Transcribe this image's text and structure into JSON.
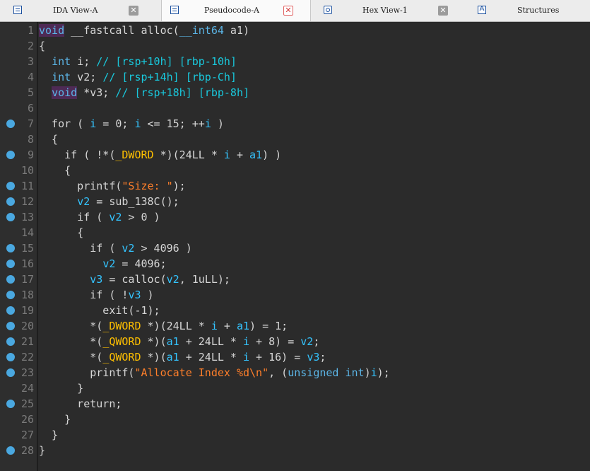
{
  "tabs": [
    {
      "label": "IDA View-A",
      "close": "✕",
      "icon": "disassembly-icon",
      "active": false
    },
    {
      "label": "Pseudocode-A",
      "close": "✕",
      "icon": "pseudocode-icon",
      "active": true
    },
    {
      "label": "Hex View-1",
      "close": "✕",
      "icon": "hex-view-icon",
      "active": false
    },
    {
      "label": "Structures",
      "icon": "structures-icon",
      "active": false
    }
  ],
  "colors": {
    "background": "#2b2b2b",
    "keyword": "#5bb4e5",
    "string": "#ff7f2a",
    "type": "#ffc000",
    "comment": "#19c8dc",
    "breakpoint": "#4aa8e0"
  },
  "lines": [
    {
      "n": "1",
      "bp": false,
      "tokens": [
        [
          "kwh",
          "void"
        ],
        [
          "p",
          " __fastcall alloc("
        ],
        [
          "kw",
          "__int64"
        ],
        [
          "p",
          " a1)"
        ]
      ]
    },
    {
      "n": "2",
      "bp": false,
      "tokens": [
        [
          "p",
          "{"
        ]
      ]
    },
    {
      "n": "3",
      "bp": false,
      "tokens": [
        [
          "p",
          "  "
        ],
        [
          "kw",
          "int"
        ],
        [
          "p",
          " i; "
        ],
        [
          "com",
          "// [rsp+10h] [rbp-10h]"
        ]
      ]
    },
    {
      "n": "4",
      "bp": false,
      "tokens": [
        [
          "p",
          "  "
        ],
        [
          "kw",
          "int"
        ],
        [
          "p",
          " v2; "
        ],
        [
          "com",
          "// [rsp+14h] [rbp-Ch]"
        ]
      ]
    },
    {
      "n": "5",
      "bp": false,
      "tokens": [
        [
          "p",
          "  "
        ],
        [
          "kwh",
          "void"
        ],
        [
          "p",
          " *v3; "
        ],
        [
          "com",
          "// [rsp+18h] [rbp-8h]"
        ]
      ]
    },
    {
      "n": "6",
      "bp": false,
      "tokens": []
    },
    {
      "n": "7",
      "bp": true,
      "tokens": [
        [
          "p",
          "  for ( "
        ],
        [
          "var",
          "i"
        ],
        [
          "p",
          " = 0; "
        ],
        [
          "var",
          "i"
        ],
        [
          "p",
          " <= 15; ++"
        ],
        [
          "var",
          "i"
        ],
        [
          "p",
          " )"
        ]
      ]
    },
    {
      "n": "8",
      "bp": false,
      "tokens": [
        [
          "p",
          "  {"
        ]
      ]
    },
    {
      "n": "9",
      "bp": true,
      "tokens": [
        [
          "p",
          "    if ( !*("
        ],
        [
          "typ",
          "_DWORD"
        ],
        [
          "p",
          " *)(24LL * "
        ],
        [
          "var",
          "i"
        ],
        [
          "p",
          " + "
        ],
        [
          "var",
          "a1"
        ],
        [
          "p",
          ") )"
        ]
      ]
    },
    {
      "n": "10",
      "bp": false,
      "tokens": [
        [
          "p",
          "    {"
        ]
      ]
    },
    {
      "n": "11",
      "bp": true,
      "tokens": [
        [
          "p",
          "      printf("
        ],
        [
          "str",
          "\"Size: \""
        ],
        [
          "p",
          ");"
        ]
      ]
    },
    {
      "n": "12",
      "bp": true,
      "tokens": [
        [
          "p",
          "      "
        ],
        [
          "var",
          "v2"
        ],
        [
          "p",
          " = sub_138C();"
        ]
      ]
    },
    {
      "n": "13",
      "bp": true,
      "tokens": [
        [
          "p",
          "      if ( "
        ],
        [
          "var",
          "v2"
        ],
        [
          "p",
          " > 0 )"
        ]
      ]
    },
    {
      "n": "14",
      "bp": false,
      "tokens": [
        [
          "p",
          "      {"
        ]
      ]
    },
    {
      "n": "15",
      "bp": true,
      "tokens": [
        [
          "p",
          "        if ( "
        ],
        [
          "var",
          "v2"
        ],
        [
          "p",
          " > 4096 )"
        ]
      ]
    },
    {
      "n": "16",
      "bp": true,
      "tokens": [
        [
          "p",
          "          "
        ],
        [
          "var",
          "v2"
        ],
        [
          "p",
          " = 4096;"
        ]
      ]
    },
    {
      "n": "17",
      "bp": true,
      "tokens": [
        [
          "p",
          "        "
        ],
        [
          "var",
          "v3"
        ],
        [
          "p",
          " = calloc("
        ],
        [
          "var",
          "v2"
        ],
        [
          "p",
          ", 1uLL);"
        ]
      ]
    },
    {
      "n": "18",
      "bp": true,
      "tokens": [
        [
          "p",
          "        if ( !"
        ],
        [
          "var",
          "v3"
        ],
        [
          "p",
          " )"
        ]
      ]
    },
    {
      "n": "19",
      "bp": true,
      "tokens": [
        [
          "p",
          "          exit(-1);"
        ]
      ]
    },
    {
      "n": "20",
      "bp": true,
      "tokens": [
        [
          "p",
          "        *("
        ],
        [
          "typ",
          "_DWORD"
        ],
        [
          "p",
          " *)(24LL * "
        ],
        [
          "var",
          "i"
        ],
        [
          "p",
          " + "
        ],
        [
          "var",
          "a1"
        ],
        [
          "p",
          ") = 1;"
        ]
      ]
    },
    {
      "n": "21",
      "bp": true,
      "tokens": [
        [
          "p",
          "        *("
        ],
        [
          "typ",
          "_QWORD"
        ],
        [
          "p",
          " *)("
        ],
        [
          "var",
          "a1"
        ],
        [
          "p",
          " + 24LL * "
        ],
        [
          "var",
          "i"
        ],
        [
          "p",
          " + 8) = "
        ],
        [
          "var",
          "v2"
        ],
        [
          "p",
          ";"
        ]
      ]
    },
    {
      "n": "22",
      "bp": true,
      "tokens": [
        [
          "p",
          "        *("
        ],
        [
          "typ",
          "_QWORD"
        ],
        [
          "p",
          " *)("
        ],
        [
          "var",
          "a1"
        ],
        [
          "p",
          " + 24LL * "
        ],
        [
          "var",
          "i"
        ],
        [
          "p",
          " + 16) = "
        ],
        [
          "var",
          "v3"
        ],
        [
          "p",
          ";"
        ]
      ]
    },
    {
      "n": "23",
      "bp": true,
      "tokens": [
        [
          "p",
          "        printf("
        ],
        [
          "str",
          "\"Allocate Index %d\\n\""
        ],
        [
          "p",
          ", ("
        ],
        [
          "kw",
          "unsigned int"
        ],
        [
          "p",
          ")"
        ],
        [
          "var",
          "i"
        ],
        [
          "p",
          ");"
        ]
      ]
    },
    {
      "n": "24",
      "bp": false,
      "tokens": [
        [
          "p",
          "      }"
        ]
      ]
    },
    {
      "n": "25",
      "bp": true,
      "tokens": [
        [
          "p",
          "      return;"
        ]
      ]
    },
    {
      "n": "26",
      "bp": false,
      "tokens": [
        [
          "p",
          "    }"
        ]
      ]
    },
    {
      "n": "27",
      "bp": false,
      "tokens": [
        [
          "p",
          "  }"
        ]
      ]
    },
    {
      "n": "28",
      "bp": true,
      "tokens": [
        [
          "p",
          "}"
        ]
      ]
    }
  ]
}
